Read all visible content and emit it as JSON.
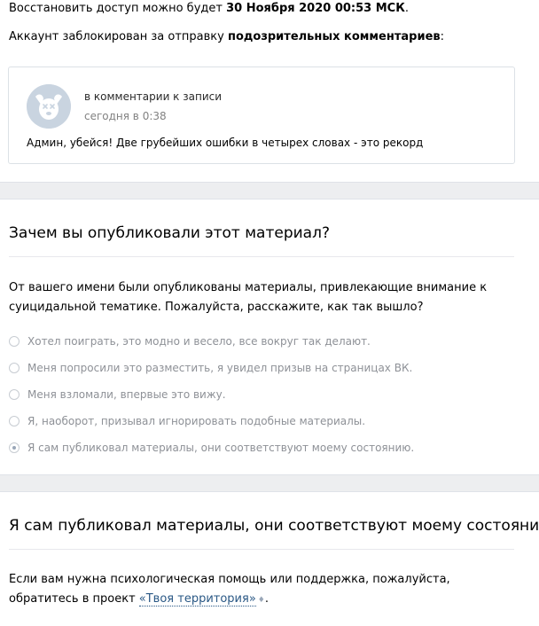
{
  "notice": {
    "restore_prefix": "Восстановить доступ можно будет ",
    "restore_date": "30 Ноября 2020 00:53 МСК",
    "restore_suffix": ".",
    "blocked_prefix": "Аккаунт заблокирован за отправку ",
    "blocked_reason": "подозрительных комментариев",
    "blocked_suffix": ":"
  },
  "comment": {
    "avatar_icon": "deactivated-dog-avatar-icon",
    "title": "в комментарии к записи",
    "time": "сегодня в 0:38",
    "text": "Админ, убейся! Две грубейших ошибки в четырех словах - это рекорд"
  },
  "question": {
    "title": "Зачем вы опубликовали этот материал?",
    "description": "От вашего имени были опубликованы материалы, привлекающие внимание к суицидальной тематике. Пожалуйста, расскажите, как так вышло?",
    "options": [
      {
        "label": "Хотел поиграть, это модно и весело, все вокруг так делают.",
        "checked": false
      },
      {
        "label": "Меня попросили это разместить, я увидел призыв на страницах ВК.",
        "checked": false
      },
      {
        "label": "Меня взломали, впервые это вижу.",
        "checked": false
      },
      {
        "label": "Я, наоборот, призывал игнорировать подобные материалы.",
        "checked": false
      },
      {
        "label": "Я сам публиковал материалы, они соответствуют моему состоянию.",
        "checked": true
      }
    ]
  },
  "answer": {
    "title": "Я сам публиковал материалы, они соответствуют моему состоянию.",
    "help_prefix": "Если вам нужна психологическая помощь или поддержка, пожалуйста, обратитесь в проект ",
    "help_link": "«Твоя территория»",
    "help_suffix": ".",
    "link_icon": "external-link-icon"
  },
  "colors": {
    "link": "#2a5885",
    "muted": "#828282",
    "separator_bg": "#edeef0"
  }
}
